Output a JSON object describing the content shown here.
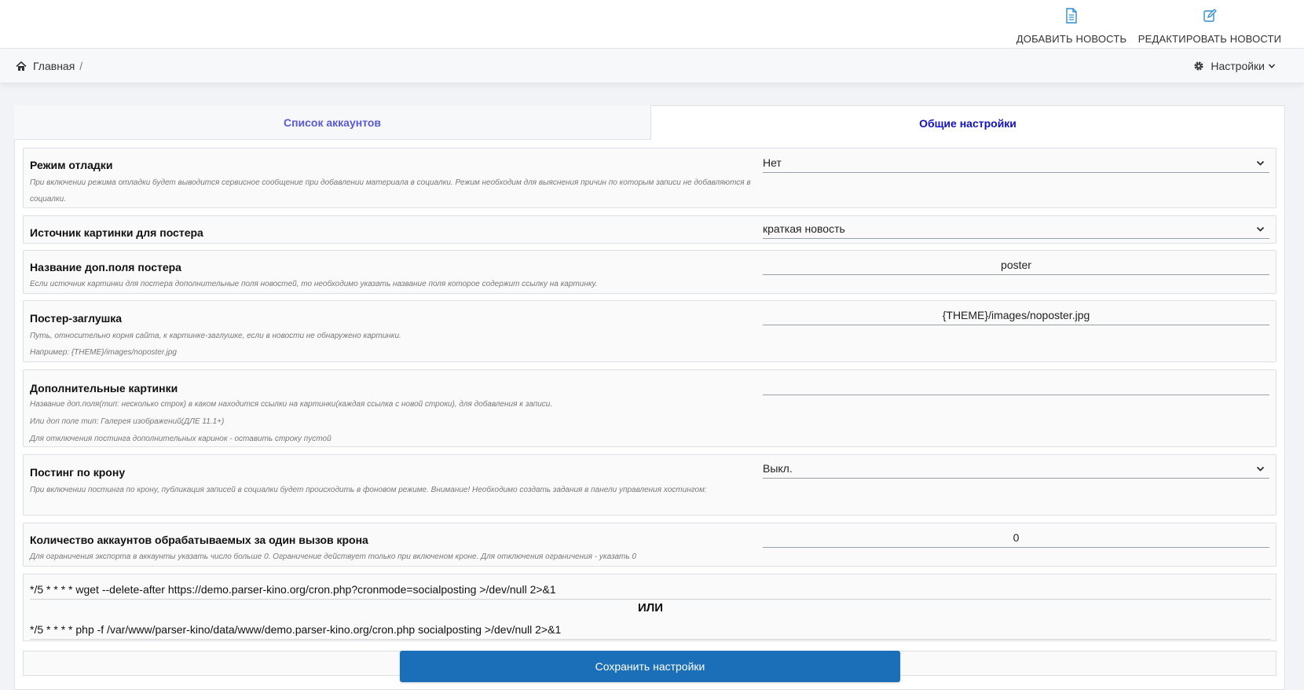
{
  "header": {
    "add_news_label": "ДОБАВИТЬ НОВОСТЬ",
    "edit_news_label": "РЕДАКТИРОВАТЬ НОВОСТИ",
    "accent_color": "#2c8fd6"
  },
  "breadcrumb": {
    "home_label": "Главная",
    "separator": "/"
  },
  "settings_menu": {
    "label": "Настройки"
  },
  "tabs": [
    {
      "label": "Список аккаунтов",
      "active": false
    },
    {
      "label": "Общие настройки",
      "active": true
    }
  ],
  "settings": {
    "debug": {
      "title": "Режим отладки",
      "hint": "При включении режима отладки будет выводится сервисное сообщение при добавлении материала в социалки. Режим необходим для выяснения причин по которым записи не добавляются в социалки.",
      "value": "Нет"
    },
    "poster_source": {
      "title": "Источник картинки для постера",
      "value": "краткая новость"
    },
    "poster_field": {
      "title": "Название доп.поля постера",
      "hint": "Если источник картинки для постера дополнительные поля новостей, то необходимо указать название поля которое содержит ссылку на картинку.",
      "value": "poster"
    },
    "poster_stub": {
      "title": "Постер-заглушка",
      "hint1": "Путь, относительно корня сайта, к картинке-заглушке, если в новости не обнаружено картинки.",
      "hint2": "Например: {THEME}/images/noposter.jpg",
      "value": "{THEME}/images/noposter.jpg"
    },
    "extra_images": {
      "title": "Дополнительные картинки",
      "hint1": "Название доп.поля(тип: несколько строк) в каком находится ссылки на картинки(каждая ссылка с новой строки), для добавления к записи.",
      "hint2": "Или доп поле тип: Галерея изображений(ДЛЕ 11.1+)",
      "hint3": "Для отключения постинга дополнительных каринок - оставить строку пустой",
      "value": ""
    },
    "cron_posting": {
      "title": "Постинг по крону",
      "hint": "При включении постинга по крону, публикация записей в социалки будет происходить в фоновом режиме. Внимание! Необходимо создать задания в панели управления хостингом:",
      "value": "Выкл."
    },
    "cron_limit": {
      "title": "Количество аккаунтов обрабатываемых за один вызов крона",
      "hint": "Для ограничения экспорта в аккаунты указать число больше 0. Ограничение действует только при включеном кроне. Для отключения ограничения - указать 0",
      "value": "0"
    }
  },
  "cron": {
    "command_wget": "*/5 * * * * wget --delete-after https://demo.parser-kino.org/cron.php?cronmode=socialposting >/dev/null 2>&1",
    "or_label": "ИЛИ",
    "command_php": "*/5 * * * * php -f /var/www/parser-kino/data/www/demo.parser-kino.org/cron.php socialposting >/dev/null 2>&1"
  },
  "save_button_label": "Сохранить настройки"
}
